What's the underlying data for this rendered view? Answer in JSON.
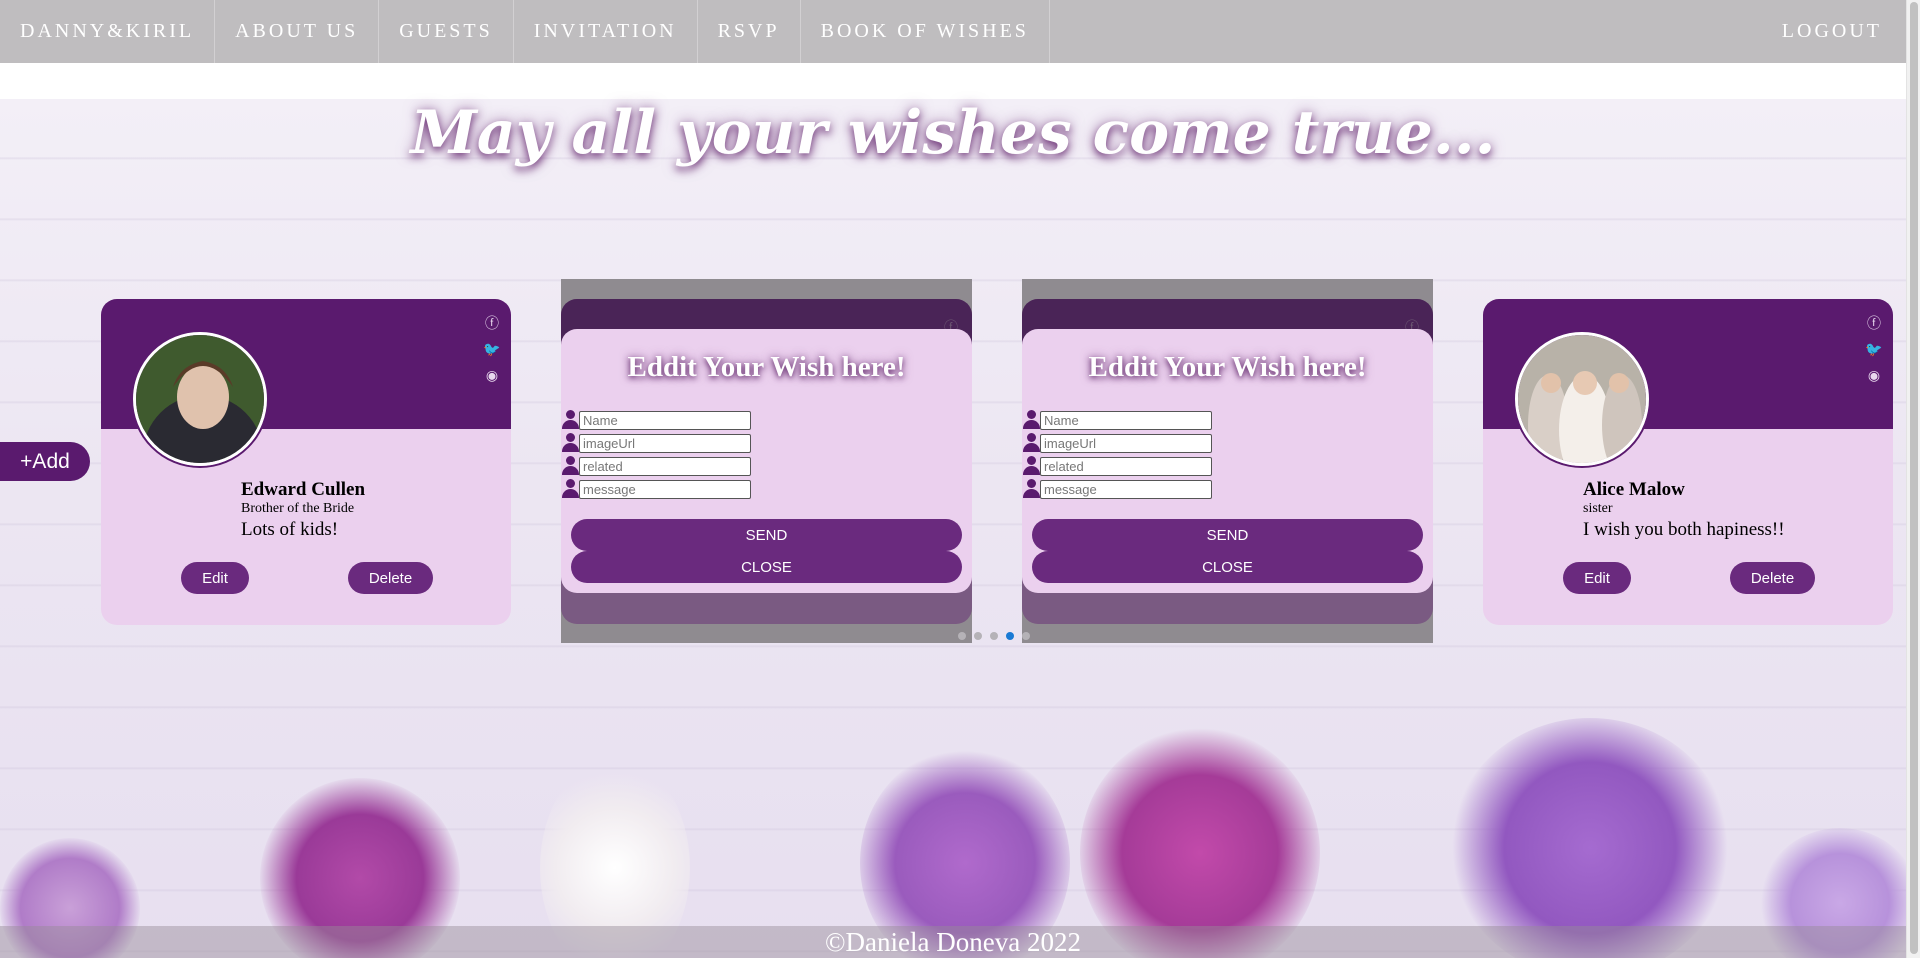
{
  "nav": {
    "brand": "DANNY&KIRIL",
    "items": [
      "ABOUT US",
      "GUESTS",
      "INVITATION",
      "RSVP",
      "BOOK OF WISHES"
    ],
    "logout": "LOGOUT"
  },
  "page": {
    "title": "May all your wishes come true...",
    "add_label": "+Add"
  },
  "cards": [
    {
      "name": "Edward Cullen",
      "related": "Brother of the Bride",
      "message": "Lots of kids!",
      "edit_label": "Edit",
      "delete_label": "Delete"
    },
    {
      "name": "Alice Malow",
      "related": "sister",
      "message": "I wish you both hapiness!!",
      "edit_label": "Edit",
      "delete_label": "Delete"
    }
  ],
  "edit_form": {
    "title": "Eddit Your Wish here!",
    "placeholders": {
      "name": "Name",
      "image": "imageUrl",
      "related": "related",
      "message": "message"
    },
    "send_label": "SEND",
    "close_label": "CLOSE"
  },
  "carousel": {
    "dot_count": 5,
    "active_dot": 4
  },
  "footer": {
    "text": "©Daniela Doneva 2022"
  },
  "colors": {
    "accent": "#5a1a6e",
    "card_bg": "#ebd0ee",
    "nav_bg": "#bfbdbf",
    "arrow": "#1a7ad4"
  },
  "icons": [
    "facebook-icon",
    "twitter-icon",
    "github-icon",
    "person-icon",
    "chevron-left-icon",
    "chevron-right-icon"
  ]
}
